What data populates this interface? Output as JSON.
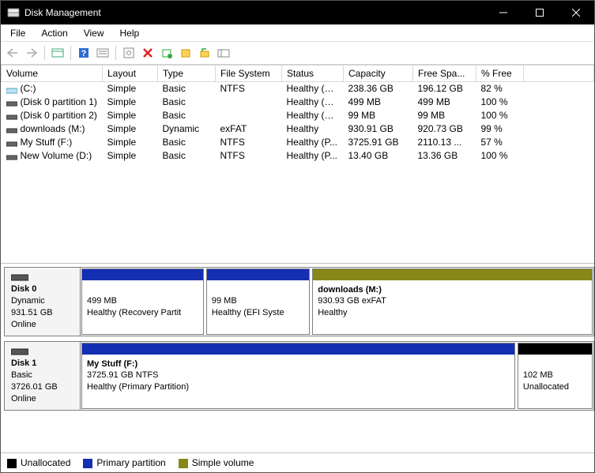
{
  "window": {
    "title": "Disk Management"
  },
  "menu": {
    "file": "File",
    "action": "Action",
    "view": "View",
    "help": "Help"
  },
  "columns": {
    "volume": "Volume",
    "layout": "Layout",
    "type": "Type",
    "fs": "File System",
    "status": "Status",
    "capacity": "Capacity",
    "free": "Free Spa...",
    "pct": "% Free"
  },
  "volumes": [
    {
      "name": "(C:)",
      "layout": "Simple",
      "type": "Basic",
      "fs": "NTFS",
      "status": "Healthy (B...",
      "cap": "238.36 GB",
      "free": "196.12 GB",
      "pct": "82 %",
      "kind": "c"
    },
    {
      "name": "(Disk 0 partition 1)",
      "layout": "Simple",
      "type": "Basic",
      "fs": "",
      "status": "Healthy (R...",
      "cap": "499 MB",
      "free": "499 MB",
      "pct": "100 %",
      "kind": "p"
    },
    {
      "name": "(Disk 0 partition 2)",
      "layout": "Simple",
      "type": "Basic",
      "fs": "",
      "status": "Healthy (E...",
      "cap": "99 MB",
      "free": "99 MB",
      "pct": "100 %",
      "kind": "p"
    },
    {
      "name": "downloads  (M:)",
      "layout": "Simple",
      "type": "Dynamic",
      "fs": "exFAT",
      "status": "Healthy",
      "cap": "930.91 GB",
      "free": "920.73 GB",
      "pct": "99 %",
      "kind": "p"
    },
    {
      "name": "My Stuff (F:)",
      "layout": "Simple",
      "type": "Basic",
      "fs": "NTFS",
      "status": "Healthy (P...",
      "cap": "3725.91 GB",
      "free": "2110.13 ...",
      "pct": "57 %",
      "kind": "p"
    },
    {
      "name": "New Volume (D:)",
      "layout": "Simple",
      "type": "Basic",
      "fs": "NTFS",
      "status": "Healthy (P...",
      "cap": "13.40 GB",
      "free": "13.36 GB",
      "pct": "100 %",
      "kind": "p"
    }
  ],
  "disks": [
    {
      "label": "Disk 0",
      "type": "Dynamic",
      "size": "931.51 GB",
      "state": "Online",
      "parts": [
        {
          "title": "",
          "line1": "499 MB",
          "line2": "Healthy (Recovery Partit",
          "line3": "",
          "color": "primary",
          "flex": 13
        },
        {
          "title": "",
          "line1": "99 MB",
          "line2": "Healthy (EFI Syste",
          "line3": "",
          "color": "primary",
          "flex": 11
        },
        {
          "title": "downloads   (M:)",
          "line1": "930.93 GB exFAT",
          "line2": "Healthy",
          "line3": "",
          "color": "simple",
          "flex": 30
        }
      ]
    },
    {
      "label": "Disk 1",
      "type": "Basic",
      "size": "3726.01 GB",
      "state": "Online",
      "parts": [
        {
          "title": "My Stuff  (F:)",
          "line1": "3725.91 GB NTFS",
          "line2": "Healthy (Primary Partition)",
          "line3": "",
          "color": "primary",
          "flex": 47
        },
        {
          "title": "",
          "line1": "102 MB",
          "line2": "Unallocated",
          "line3": "",
          "color": "unalloc",
          "flex": 8
        }
      ]
    }
  ],
  "legend": {
    "unalloc": "Unallocated",
    "primary": "Primary partition",
    "simple": "Simple volume"
  }
}
